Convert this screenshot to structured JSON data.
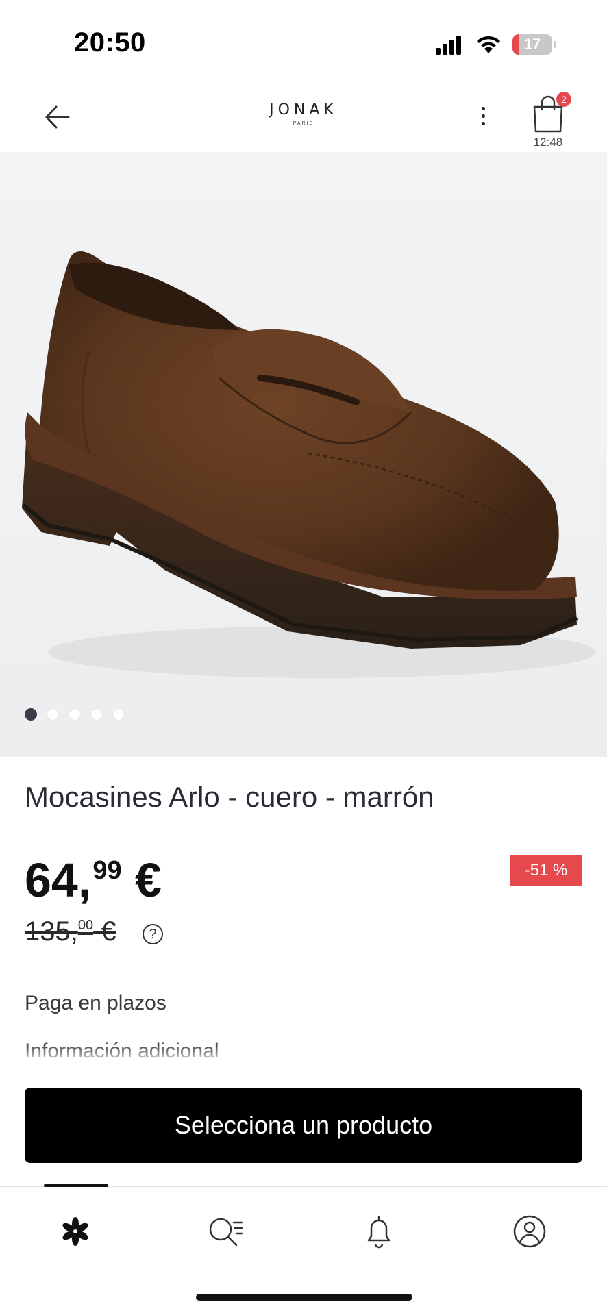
{
  "status_bar": {
    "time": "20:50",
    "battery_level": "17",
    "battery_color": "#e5484d"
  },
  "header": {
    "logo_main": "JONAK",
    "logo_sub": "PARIS",
    "cart_count": "2",
    "cart_timer": "12:48",
    "icons": [
      "arrow-left-icon",
      "more-vertical-icon",
      "shopping-bag-icon"
    ]
  },
  "gallery": {
    "image": "brown-suede-loafer",
    "page_count": 5,
    "active_page": 1
  },
  "product": {
    "title": "Mocasines Arlo - cuero - marrón",
    "price_current_int": "64,",
    "price_current_dec": "99",
    "price_current_currency": " €",
    "price_old_int": "135,",
    "price_old_dec": "00",
    "price_old_currency": " €",
    "help_symbol": "?",
    "discount": "-51 %",
    "discount_color": "#e5484d"
  },
  "info_links": {
    "installments": "Paga en plazos",
    "additional_info": "Información adicional"
  },
  "cta": {
    "label": "Selecciona un producto"
  },
  "tab_bar": {
    "active_tab": "home",
    "tabs": [
      "home-flower-icon",
      "search-list-icon",
      "bell-icon",
      "account-icon"
    ]
  }
}
